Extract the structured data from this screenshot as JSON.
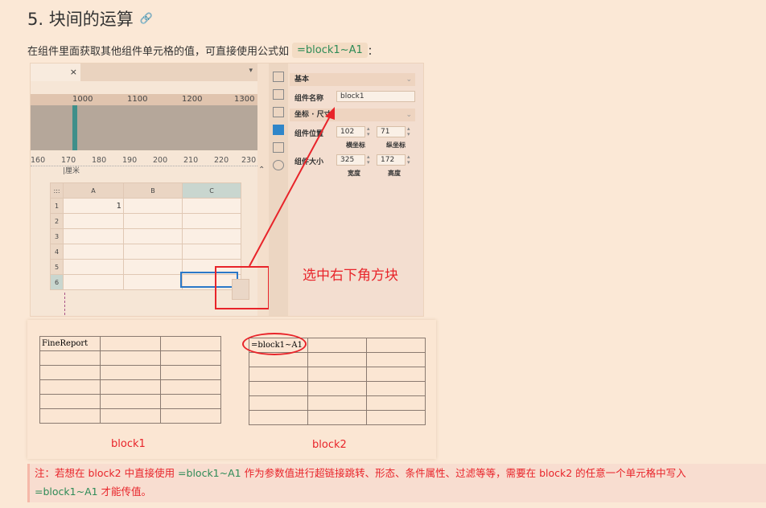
{
  "heading": {
    "title": "5. 块间的运算",
    "link_icon": "link-icon"
  },
  "intro": {
    "text": "在组件里面获取其他组件单元格的值，可直接使用公式如",
    "code": "=block1~A1",
    "suffix": "："
  },
  "screenshot1": {
    "tab_close": "×",
    "ruler_top": [
      "1000",
      "1100",
      "1200",
      "1300"
    ],
    "ruler_bottom": [
      "160",
      "170",
      "180",
      "190",
      "200",
      "210",
      "220",
      "230"
    ],
    "unit": "|厘米",
    "columns": [
      "A",
      "B",
      "C"
    ],
    "rows": [
      "1",
      "2",
      "3",
      "4",
      "5",
      "6"
    ],
    "corner": ":::",
    "cell_a1": "1",
    "panel": {
      "section_basic": "基本",
      "name_label": "组件名称",
      "name_value": "block1",
      "section_coord": "坐标 · 尺寸",
      "pos_label": "组件位置",
      "pos_x": "102",
      "pos_y": "71",
      "pos_x_label": "横坐标",
      "pos_y_label": "纵坐标",
      "size_label": "组件大小",
      "width": "325",
      "height": "172",
      "width_label": "宽度",
      "height_label": "高度"
    },
    "callout": "选中右下角方块"
  },
  "screenshot2": {
    "block1_cell": "FineReport",
    "block2_cell": "=block1~A1",
    "block1_label": "block1",
    "block2_label": "block2"
  },
  "note": {
    "p1": "注：若想在 block2 中直接使用 ",
    "code1": "=block1~A1",
    "p2": " 作为参数值进行超链接跳转、形态、条件属性、过滤等等，需要在 block2 的任意一个单元格中写入",
    "code2": "=block1~A1",
    "p3": " 才能传值。"
  },
  "colors": {
    "accent_red": "#e8242a",
    "code_green": "#2e8b57",
    "selection_blue": "#2a78c8"
  }
}
